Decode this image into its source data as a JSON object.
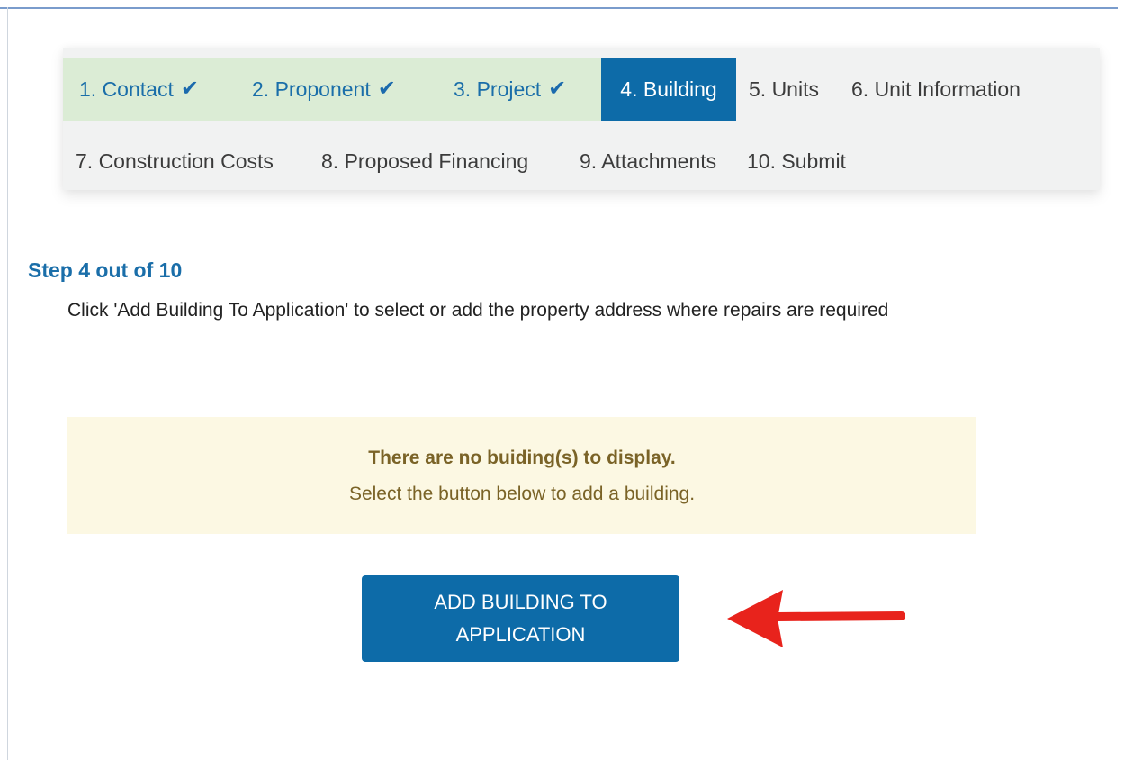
{
  "wizard": {
    "steps": [
      {
        "label": "1. Contact",
        "status": "done"
      },
      {
        "label": "2. Proponent",
        "status": "done"
      },
      {
        "label": "3. Project",
        "status": "done"
      },
      {
        "label": "4. Building",
        "status": "active"
      },
      {
        "label": "5. Units",
        "status": "pending"
      },
      {
        "label": "6. Unit Information",
        "status": "pending"
      },
      {
        "label": "7. Construction Costs",
        "status": "pending"
      },
      {
        "label": "8. Proposed Financing",
        "status": "pending"
      },
      {
        "label": "9. Attachments",
        "status": "pending"
      },
      {
        "label": "10. Submit",
        "status": "pending"
      }
    ],
    "check_icon": "✔"
  },
  "page": {
    "step_heading": "Step 4 out of 10",
    "instructions": "Click 'Add Building To Application' to select or add the property address where repairs are required"
  },
  "notice": {
    "title": "There are no buiding(s) to display.",
    "subtitle": "Select the button below to add a building."
  },
  "actions": {
    "add_building_line1": "ADD BUILDING TO",
    "add_building_line2": "APPLICATION"
  },
  "icons": {
    "check": "checkmark-icon",
    "pointer": "red-arrow-left"
  },
  "colors": {
    "accent": "#0d6ba8",
    "done_bg": "#dbecd5",
    "done_text": "#1a6ea9",
    "notice_bg": "#fcf8e3",
    "notice_text": "#7a6327",
    "arrow": "#e8231c"
  }
}
